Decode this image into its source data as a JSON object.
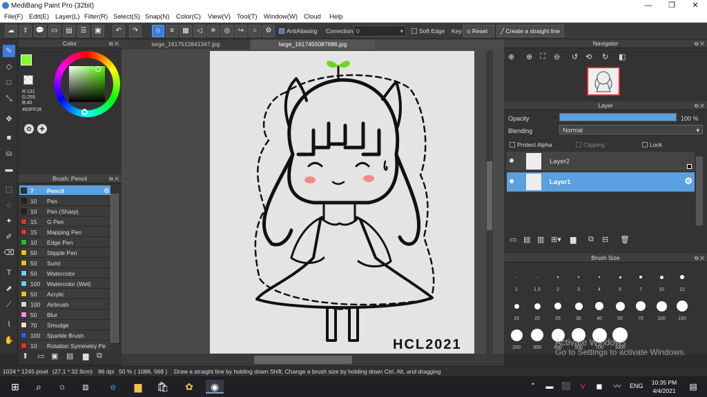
{
  "window": {
    "title": "MediBang Paint Pro (32bit)",
    "minimize": "—",
    "maximize": "❐",
    "close": "✕"
  },
  "menu": [
    "File(F)",
    "Edit(E)",
    "Layer(L)",
    "Filter(R)",
    "Select(S)",
    "Snap(N)",
    "Color(C)",
    "View(V)",
    "Tool(T)",
    "Window(W)",
    "Cloud",
    "Help"
  ],
  "toolbar": {
    "antialiasing": "AntiAliasing",
    "correction_label": "Correction",
    "correction_value": "0",
    "soft_edge": "Soft Edge",
    "key": "Key",
    "reset": "Reset",
    "straight_line": "Create a straight line"
  },
  "color_panel": {
    "title": "Color",
    "r": "R:131",
    "g": "G:255",
    "b": "B:40",
    "hex": "#83FF28",
    "fg": "#83FF28",
    "bg": "#000000"
  },
  "brush_panel": {
    "title": "Brush: Pencil",
    "items": [
      {
        "size": "7",
        "name": "Pencil",
        "color": "#333333"
      },
      {
        "size": "10",
        "name": "Pen",
        "color": "#222222"
      },
      {
        "size": "10",
        "name": "Pen (Sharp)",
        "color": "#222222"
      },
      {
        "size": "15",
        "name": "G Pen",
        "color": "#e53030"
      },
      {
        "size": "15",
        "name": "Mapping Pen",
        "color": "#e53030"
      },
      {
        "size": "10",
        "name": "Edge Pen",
        "color": "#2bbf2b"
      },
      {
        "size": "50",
        "name": "Stipple Pen",
        "color": "#e8c21a"
      },
      {
        "size": "50",
        "name": "Sumi",
        "color": "#e8c21a"
      },
      {
        "size": "50",
        "name": "Watercolor",
        "color": "#6fd0f0"
      },
      {
        "size": "100",
        "name": "Watercolor (Wet)",
        "color": "#6fd0f0"
      },
      {
        "size": "50",
        "name": "Acrylic",
        "color": "#e8c21a"
      },
      {
        "size": "100",
        "name": "Airbrush",
        "color": "#d9d9d9"
      },
      {
        "size": "50",
        "name": "Blur",
        "color": "#f28ee8"
      },
      {
        "size": "70",
        "name": "Smudge",
        "color": "#f3e1c4"
      },
      {
        "size": "100",
        "name": "Sparkle Brush",
        "color": "#2f5fe0"
      },
      {
        "size": "10",
        "name": "Rotation Symmetry Pe",
        "color": "#e53030"
      }
    ]
  },
  "tabs": [
    "large_1617512841347.jpg",
    "large_1617455087686.jpg"
  ],
  "artwork": {
    "signature": "HCL2021"
  },
  "navigator": {
    "title": "Navigator"
  },
  "layer_panel": {
    "title": "Layer",
    "opacity_label": "Opacity",
    "opacity_value": "100 %",
    "opacity_fraction": 1.0,
    "blending_label": "Blending",
    "blending_value": "Normal",
    "protect_alpha": "Protect Alpha",
    "clipping": "Clipping",
    "lock": "Lock",
    "layers": [
      {
        "name": "Layer2",
        "selected": false
      },
      {
        "name": "Layer1",
        "selected": true
      }
    ]
  },
  "brush_size": {
    "title": "Brush Size",
    "row1": [
      "1",
      "1.5",
      "2",
      "3",
      "4",
      "5",
      "7",
      "10",
      "12"
    ],
    "row2": [
      "15",
      "20",
      "25",
      "30",
      "40",
      "50",
      "70",
      "100",
      "150"
    ],
    "row3": [
      "200",
      "300",
      "400",
      "500",
      "700",
      "1000"
    ]
  },
  "status": {
    "dims": "1024 * 1245 pixel",
    "cm": "(27.1 * 32.9cm)",
    "dpi": "96 dpi",
    "zoom": "50 %",
    "coords": "( 1086, 568 )",
    "hint": "Draw a straight line by holding down Shift, Change a brush size by holding down Ctrl, Alt, and dragging"
  },
  "watermark": {
    "line1": "Activate Windows",
    "line2": "Go to Settings to activate Windows."
  },
  "taskbar": {
    "lang": "ENG",
    "time": "10:35 PM",
    "date": "4/4/2021"
  }
}
